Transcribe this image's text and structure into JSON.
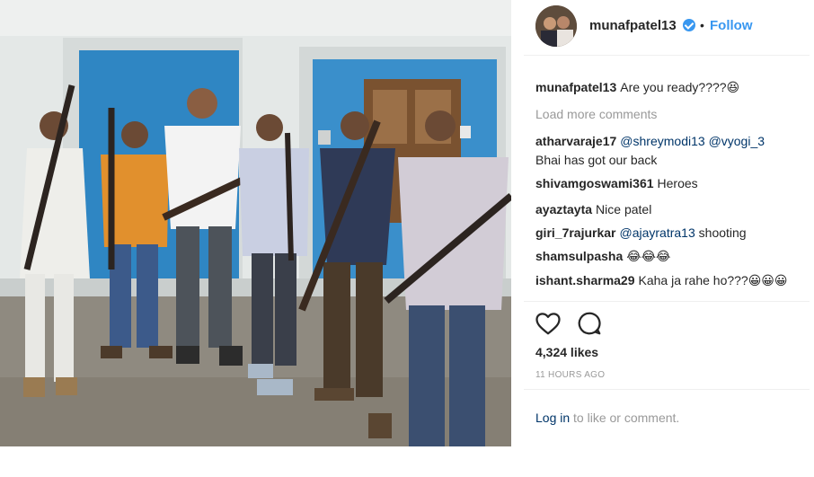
{
  "post": {
    "username": "munafpatel13",
    "separator": "•",
    "follow_label": "Follow"
  },
  "caption": {
    "user": "munafpatel13",
    "text": "Are you ready????😆"
  },
  "load_more": "Load more comments",
  "comments": [
    {
      "user": "atharvaraje17",
      "mention1": "@shreymodi13",
      "mention2": "@vyogi_3",
      "text": "Bhai has got our back"
    },
    {
      "user": "shivamgoswami361",
      "text": "Heroes"
    },
    {
      "user": "ayaztayta",
      "text": "Nice patel"
    },
    {
      "user": "giri_7rajurkar",
      "mention1": "@ajayratra13",
      "text": "shooting"
    },
    {
      "user": "shamsulpasha",
      "text": "😂😂😂"
    },
    {
      "user": "ishant.sharma29",
      "text": "Kaha ja rahe ho???😀😀😀"
    }
  ],
  "actions": {
    "like_icon": "heart-outline-icon",
    "comment_icon": "speech-bubble-icon"
  },
  "likes": "4,324 likes",
  "timestamp": "11 HOURS AGO",
  "login": {
    "link": "Log in",
    "rest": "to like or comment."
  },
  "colors": {
    "link_blue": "#3897f0",
    "mention": "#003569",
    "muted": "#999999",
    "text": "#262626",
    "wall": "#e3e7e6",
    "door_blue": "#2f86c3"
  }
}
